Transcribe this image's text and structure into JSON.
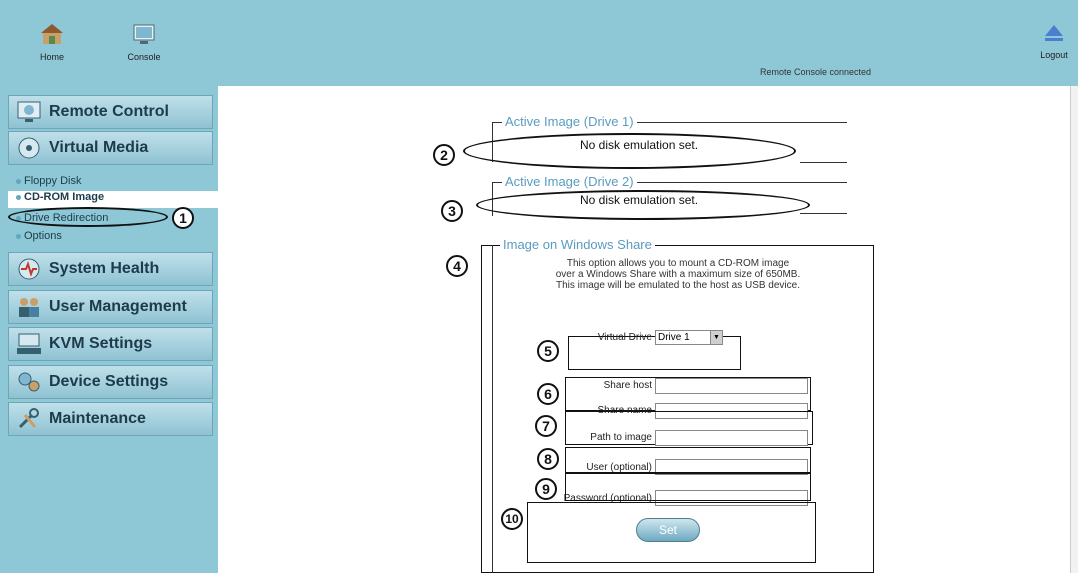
{
  "header": {
    "home_label": "Home",
    "console_label": "Console",
    "status_text": "Remote Console connected",
    "logout_label": "Logout"
  },
  "sidebar": {
    "remote_control": "Remote Control",
    "virtual_media": "Virtual Media",
    "sub_items": [
      "Floppy Disk",
      "CD-ROM Image",
      "Drive Redirection",
      "Options"
    ],
    "system_health": "System Health",
    "user_management": "User Management",
    "kvm_settings": "KVM Settings",
    "device_settings": "Device Settings",
    "maintenance": "Maintenance"
  },
  "main": {
    "drive1_legend": "Active Image (Drive 1)",
    "drive1_msg": "No disk emulation set.",
    "drive2_legend": "Active Image (Drive 2)",
    "drive2_msg": "No disk emulation set.",
    "share_legend": "Image on Windows Share",
    "share_desc_1": "This option allows you to mount a CD-ROM image",
    "share_desc_2": "over a Windows Share with a maximum size of 650MB.",
    "share_desc_3": "This image will be emulated to the host as USB device.",
    "virtual_drive_label": "Virtual Drive",
    "virtual_drive_value": "Drive 1",
    "share_host_label": "Share host",
    "share_name_label": "Share name",
    "path_label": "Path to image",
    "user_label": "User (optional)",
    "password_label": "Password (optional)",
    "set_label": "Set"
  },
  "callouts": [
    "1",
    "2",
    "3",
    "4",
    "5",
    "6",
    "7",
    "8",
    "9",
    "10"
  ],
  "colors": {
    "panel": "#8ec7d6",
    "legend": "#5a9bc0"
  }
}
